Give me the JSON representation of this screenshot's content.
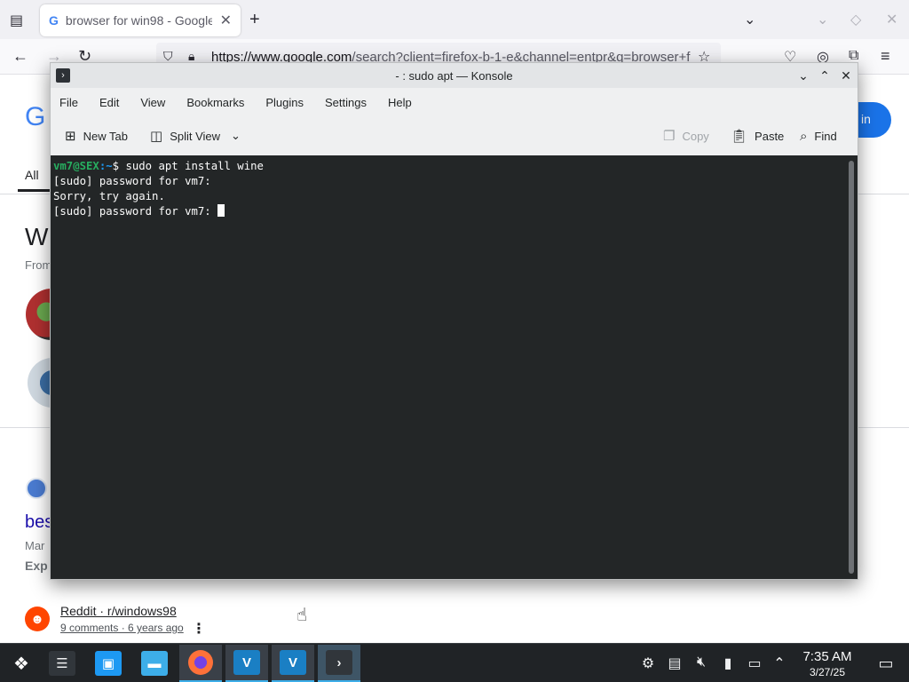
{
  "firefox": {
    "tab_title": "browser for win98 - Google",
    "tab_favicon": "G",
    "url_host": "https://www.google.com",
    "url_rest": "/search?client=firefox-b-1-e&channel=entpr&q=browser+f",
    "icons": {
      "list_all_tabs": "tabs-icon",
      "new_tab": "plus-icon",
      "back": "back-arrow-icon",
      "forward": "forward-arrow-icon",
      "reload": "reload-icon",
      "bookmark": "star-icon",
      "pocket": "pocket-icon",
      "account": "account-icon",
      "extensions": "puzzle-icon",
      "menu": "hamburger-icon"
    }
  },
  "google": {
    "logo_fragment": "G",
    "tab_all": "All",
    "heading_fragment": "W",
    "from_fragment": "From",
    "result_link_fragment": "bes",
    "date_fragment": "Mar",
    "exp_fragment": "Exp",
    "signin_fragment": "in",
    "reddit_source": "Reddit · r/windows98",
    "reddit_meta": "9 comments · 6 years ago",
    "more_icon": "⋮"
  },
  "konsole": {
    "title": "- : sudo apt — Konsole",
    "menu": [
      "File",
      "Edit",
      "View",
      "Bookmarks",
      "Plugins",
      "Settings",
      "Help"
    ],
    "toolbar": {
      "new_tab": "New Tab",
      "split_view": "Split View",
      "copy": "Copy",
      "paste": "Paste",
      "find": "Find"
    },
    "terminal": {
      "prompt_user": "vm7@SEX",
      "prompt_path": ":~",
      "prompt_symbol": "$ ",
      "command": "sudo apt install wine",
      "line2": "[sudo] password for vm7:",
      "line3": "Sorry, try again.",
      "line4": "[sudo] password for vm7: "
    },
    "colors": {
      "terminal_bg": "#232627",
      "prompt_user": "#27ae60",
      "prompt_path": "#1d99f3"
    }
  },
  "taskbar": {
    "time": "7:35 AM",
    "date": "3/27/25",
    "apps": [
      "app-launcher",
      "system-settings",
      "discover-store",
      "file-manager",
      "firefox",
      "virtualbox",
      "virtualbox",
      "konsole"
    ],
    "accent": "#3daee9"
  }
}
